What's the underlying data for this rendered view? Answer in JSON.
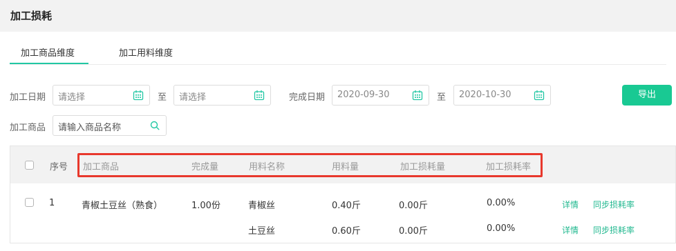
{
  "header": {
    "title": "加工损耗"
  },
  "tabs": [
    {
      "label": "加工商品维度",
      "active": true
    },
    {
      "label": "加工用料维度",
      "active": false
    }
  ],
  "filters": {
    "process_date_label": "加工日期",
    "process_date_start_placeholder": "请选择",
    "process_date_to": "至",
    "process_date_end_placeholder": "请选择",
    "finish_date_label": "完成日期",
    "finish_date_start": "2020-09-30",
    "finish_date_to": "至",
    "finish_date_end": "2020-10-30",
    "product_label": "加工商品",
    "product_placeholder": "请输入商品名称"
  },
  "export_label": "导出",
  "table": {
    "columns": [
      "序号",
      "加工商品",
      "完成量",
      "用料名称",
      "用料量",
      "加工损耗量",
      "加工损耗率"
    ],
    "row": {
      "seq": "1",
      "product": "青椒土豆丝（熟食）",
      "finished": "1.00份",
      "materials": [
        {
          "name": "青椒丝",
          "amount": "0.40斤",
          "loss": "0.00斤",
          "rate": "0.00%",
          "detail": "详情",
          "sync": "同步损耗率"
        },
        {
          "name": "土豆丝",
          "amount": "0.60斤",
          "loss": "0.00斤",
          "rate": "0.00%",
          "detail": "详情",
          "sync": "同步损耗率"
        }
      ]
    }
  },
  "colors": {
    "accent": "#19c993",
    "highlight": "#e8382c"
  },
  "icons": {
    "calendar": "calendar-icon",
    "search": "search-icon"
  }
}
